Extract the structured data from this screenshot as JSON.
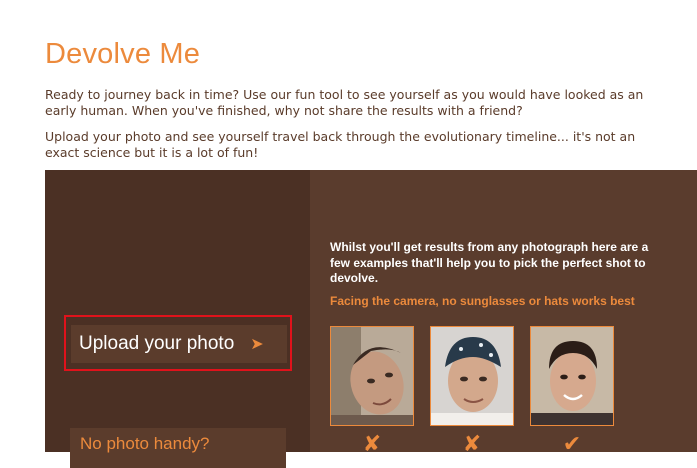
{
  "page": {
    "title": "Devolve Me",
    "intro_1": "Ready to journey back in time? Use our fun tool to see yourself as you would have looked as an early human. When you've finished, why not share the results with a friend?",
    "intro_2": "Upload your photo and see yourself travel back through the evolutionary timeline... it's not an exact science but it is a lot of fun!"
  },
  "uploader": {
    "upload_label": "Upload your photo",
    "upload_arrow": "➤",
    "no_photo_label": "No photo handy?"
  },
  "examples": {
    "text": "Whilst you'll get results from any photograph here are a few examples that'll help you to pick the perfect shot to devolve.",
    "hint": "Facing the camera, no sunglasses or hats works best",
    "photos": [
      {
        "verdict": "✘",
        "good": false
      },
      {
        "verdict": "✘",
        "good": false
      },
      {
        "verdict": "✔",
        "good": true
      }
    ]
  },
  "colors": {
    "accent": "#ec8a3c",
    "panel": "#5a3c2d",
    "panel_dark": "#4b3024",
    "highlight": "#e0121b"
  }
}
